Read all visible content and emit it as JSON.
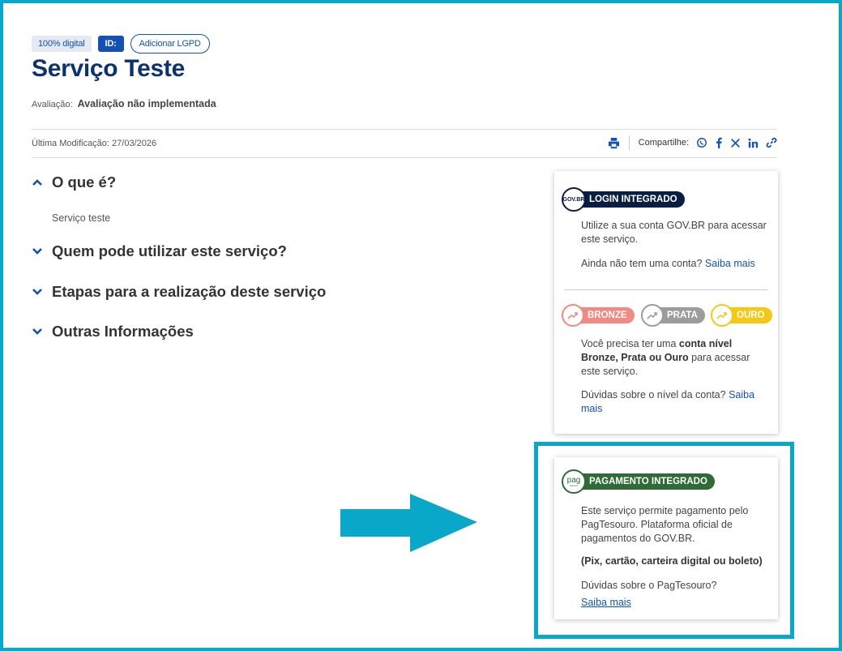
{
  "tags": {
    "digital": "100% digital",
    "id": "ID:",
    "lgpd": "Adicionar LGPD"
  },
  "title": "Serviço Teste",
  "rating": {
    "label": "Avaliação:",
    "value": "Avaliação não implementada"
  },
  "modified": "Última Modificação: 27/03/2026",
  "share": {
    "label": "Compartilhe:",
    "icons": [
      "print-icon",
      "whatsapp-icon",
      "facebook-icon",
      "x-icon",
      "linkedin-icon",
      "link-icon"
    ]
  },
  "accordion": [
    {
      "q": "O que é?",
      "expanded": true,
      "body": "Serviço teste"
    },
    {
      "q": "Quem pode utilizar este serviço?",
      "expanded": false
    },
    {
      "q": "Etapas para a realização deste serviço",
      "expanded": false
    },
    {
      "q": "Outras Informações",
      "expanded": false
    }
  ],
  "login_card": {
    "logo": "GOV.BR",
    "badge": "LOGIN INTEGRADO",
    "text1": "Utilize a sua conta GOV.BR para acessar este serviço.",
    "text2_prefix": "Ainda não tem uma conta?",
    "text2_link": "Saiba mais",
    "levels": [
      "BRONZE",
      "PRATA",
      "OURO"
    ],
    "level_colors": {
      "bronze": "#f28a83",
      "prata": "#9c9c9c",
      "ouro": "#f5c815"
    },
    "level_t1": "Você precisa ter uma",
    "level_b1": "conta nível Bronze, Prata ou Ouro",
    "level_t2": "para acessar este serviço.",
    "doubts_prefix": "Dúvidas sobre o nível da conta?",
    "doubts_link": "Saiba mais"
  },
  "payment_card": {
    "logo": "pag",
    "logo_sub": "Tesouro",
    "badge": "PAGAMENTO INTEGRADO",
    "text1": "Este serviço permite pagamento pelo PagTesouro. Plataforma oficial de pagamentos do GOV.BR.",
    "bold": "(Pix, cartão, carteira digital ou boleto)",
    "doubts": "Dúvidas sobre o PagTesouro?",
    "link": "Saiba mais"
  },
  "colors": {
    "primary": "#1351b4",
    "title": "#0c326f",
    "navy": "#071d41",
    "green": "#2e6b36",
    "highlight": "#0aa8c8"
  }
}
